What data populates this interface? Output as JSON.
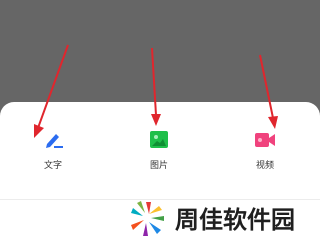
{
  "options": [
    {
      "key": "text",
      "label": "文字",
      "icon": "pen-icon",
      "color": "#2b6cf0"
    },
    {
      "key": "image",
      "label": "图片",
      "icon": "image-icon",
      "color": "#1fbf4a"
    },
    {
      "key": "video",
      "label": "视频",
      "icon": "video-camera-icon",
      "color": "#f0427d"
    }
  ],
  "colors": {
    "overlay": "#666666",
    "sheet": "#ffffff",
    "arrow": "#e0262d"
  },
  "watermark": {
    "text": "周佳软件园"
  }
}
